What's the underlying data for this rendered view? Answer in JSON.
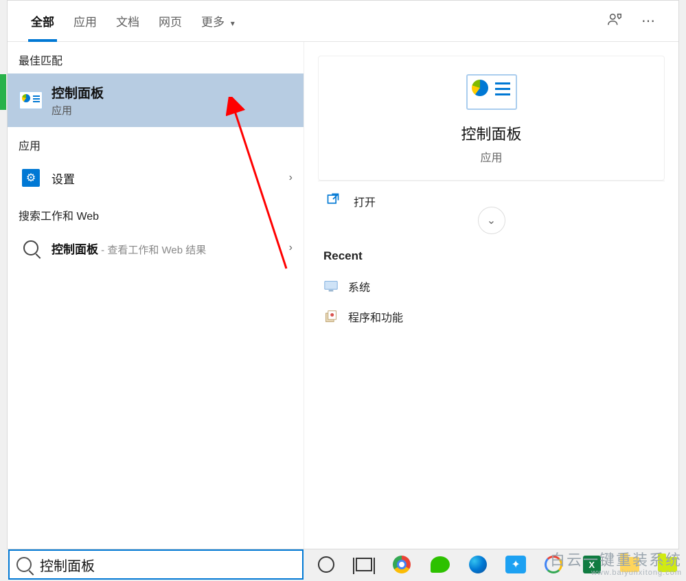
{
  "tabs": {
    "all": "全部",
    "apps": "应用",
    "docs": "文档",
    "web": "网页",
    "more": "更多"
  },
  "sections": {
    "best_match": "最佳匹配",
    "apps": "应用",
    "search_web": "搜索工作和 Web"
  },
  "best": {
    "title": "控制面板",
    "subtitle": "应用"
  },
  "app_results": {
    "settings": "设置"
  },
  "web_results": {
    "prefix": "控制面板",
    "suffix": " - 查看工作和 Web 结果"
  },
  "preview": {
    "title": "控制面板",
    "subtitle": "应用",
    "open": "打开",
    "recent_header": "Recent",
    "recent": {
      "system": "系统",
      "programs": "程序和功能"
    }
  },
  "search": {
    "value": "控制面板"
  },
  "watermark": {
    "line1": "白云一键重装系统",
    "line2": "www.baiyunxitong.com"
  }
}
